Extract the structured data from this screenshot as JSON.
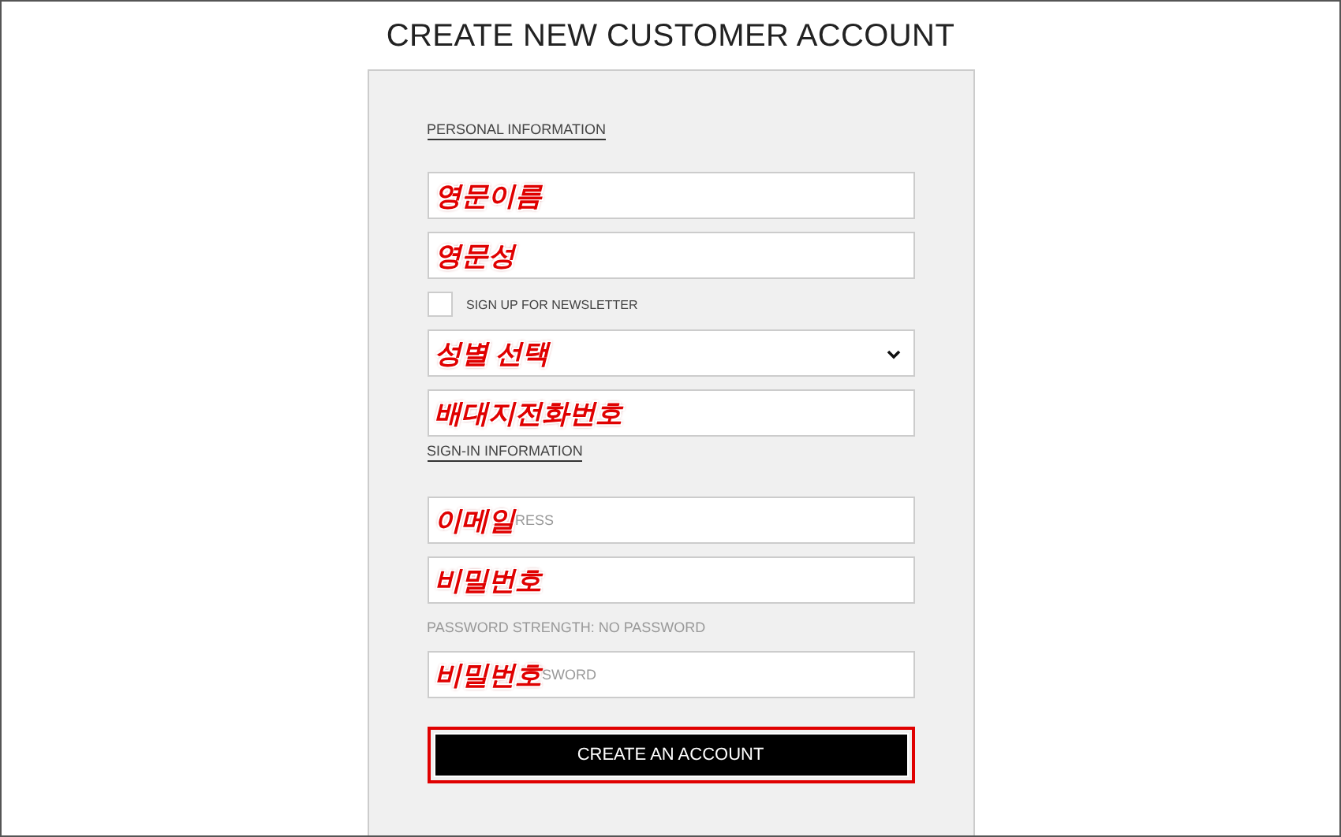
{
  "title": "CREATE NEW CUSTOMER ACCOUNT",
  "sections": [
    {
      "heading": "PERSONAL INFORMATION",
      "items": [
        {
          "kind": "text",
          "annotation": "영문이름"
        },
        {
          "kind": "text",
          "annotation": "영문성"
        },
        {
          "kind": "checkbox",
          "label": "SIGN UP FOR NEWSLETTER",
          "checked": false
        },
        {
          "kind": "select",
          "annotation": "성별 선택"
        },
        {
          "kind": "text",
          "annotation": "배대지전화번호"
        }
      ]
    },
    {
      "heading": "SIGN-IN INFORMATION",
      "items": [
        {
          "kind": "text",
          "annotation": "이메일",
          "placeholder": "RESS"
        },
        {
          "kind": "text",
          "annotation": "비밀번호"
        },
        {
          "kind": "note",
          "text": "PASSWORD STRENGTH: NO PASSWORD"
        },
        {
          "kind": "text",
          "annotation": "비밀번호",
          "placeholder": "SWORD"
        }
      ]
    }
  ],
  "button": {
    "label": "CREATE AN ACCOUNT",
    "highlighted": true
  }
}
